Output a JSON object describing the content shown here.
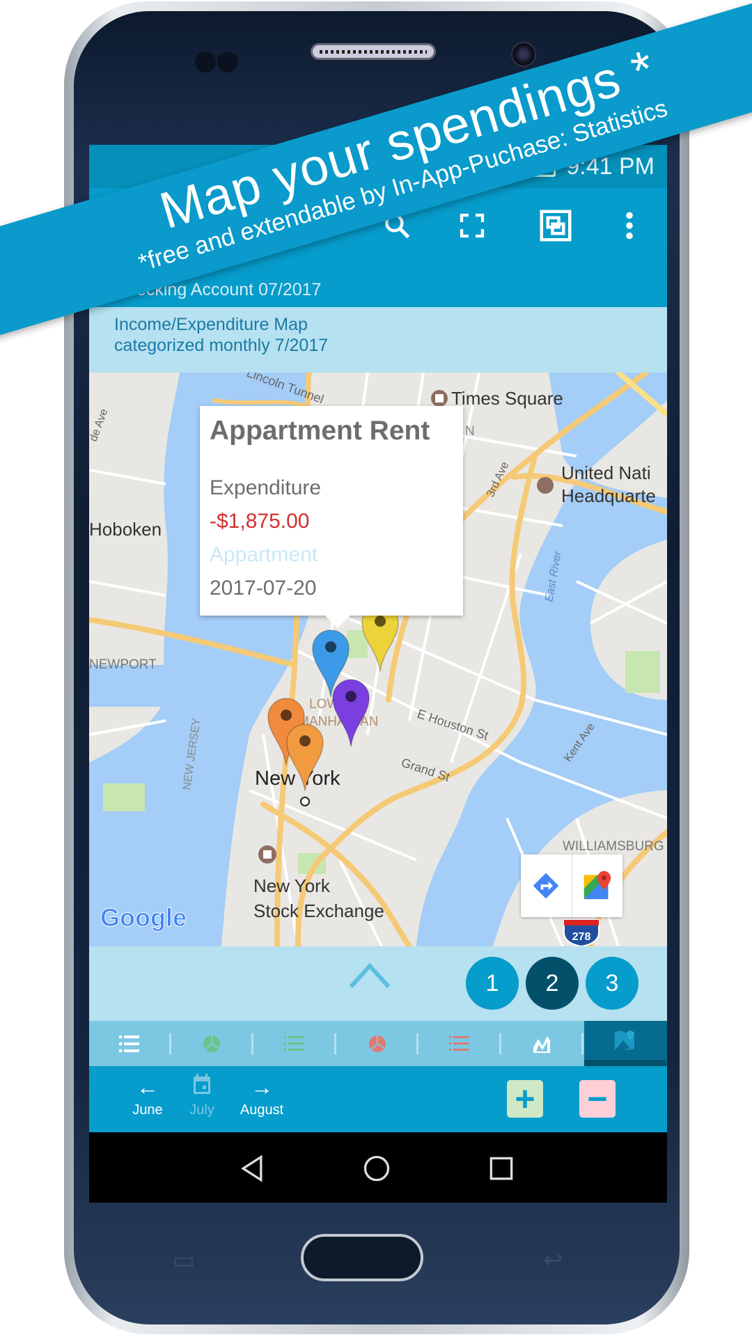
{
  "banner": {
    "headline": "Map your spendings *",
    "subline": "*free and extendable by In-App-Puchase: Statistics"
  },
  "status_bar": {
    "time": "9:41 PM"
  },
  "toolbar": {
    "icons": [
      "search-icon",
      "fullscreen-icon",
      "select-area-icon",
      "more-vert-icon"
    ]
  },
  "account_label": "Checking Account 07/2017",
  "header": {
    "line1": "Income/Expenditure Map",
    "line2": "categorized monthly 7/2017"
  },
  "map": {
    "labels": {
      "times_square": "Times Square",
      "hoboken": "Hoboken",
      "un1": "United Nati",
      "un2": "Headquarte",
      "newport": "NEWPORT",
      "new_york": "New York",
      "nyse1": "New York",
      "nyse2": "Stock Exchange",
      "williamsburg": "WILLIAMSBURG",
      "east_river": "East River",
      "houston": "E Houston St",
      "grand": "Grand St",
      "kent": "Kent Ave",
      "third": "3rd Ave",
      "lincoln": "Lincoln Tunnel",
      "nj": "NEW JERSEY",
      "lower1": "LOWER",
      "lower2": "MANHATTAN",
      "midtown": "N",
      "highway": "278",
      "hudson_ave": "de Ave",
      "google": "Google"
    },
    "colors": {
      "water": "#a4cdf7",
      "land": "#e9e7e3",
      "highway": "#f6c976",
      "blue_pin": "#3d9ae8",
      "yellow_pin": "#ecd33a",
      "purple_pin": "#7b3fe0",
      "orange_pin": "#f08a3c",
      "orange_pin2": "#f29a40"
    },
    "popup": {
      "title": "Appartment Rent",
      "type": "Expenditure",
      "amount": "-$1,875.00",
      "category": "Appartment",
      "date": "2017-07-20",
      "amount_color": "#d32f2f",
      "category_color": "#c9e8f6"
    }
  },
  "pager": {
    "pages": [
      "1",
      "2",
      "3"
    ],
    "selected": "2"
  },
  "tabs": [
    "list-numbered-icon",
    "pie-green-icon",
    "list-green-icon",
    "pie-red-icon",
    "list-red-icon",
    "line-chart-icon",
    "map-icon"
  ],
  "tab_selected": "map-icon",
  "bottom": {
    "prev": "June",
    "current": "July",
    "next": "August",
    "add": "+",
    "subtract": "−"
  },
  "accent": "#069ccb"
}
